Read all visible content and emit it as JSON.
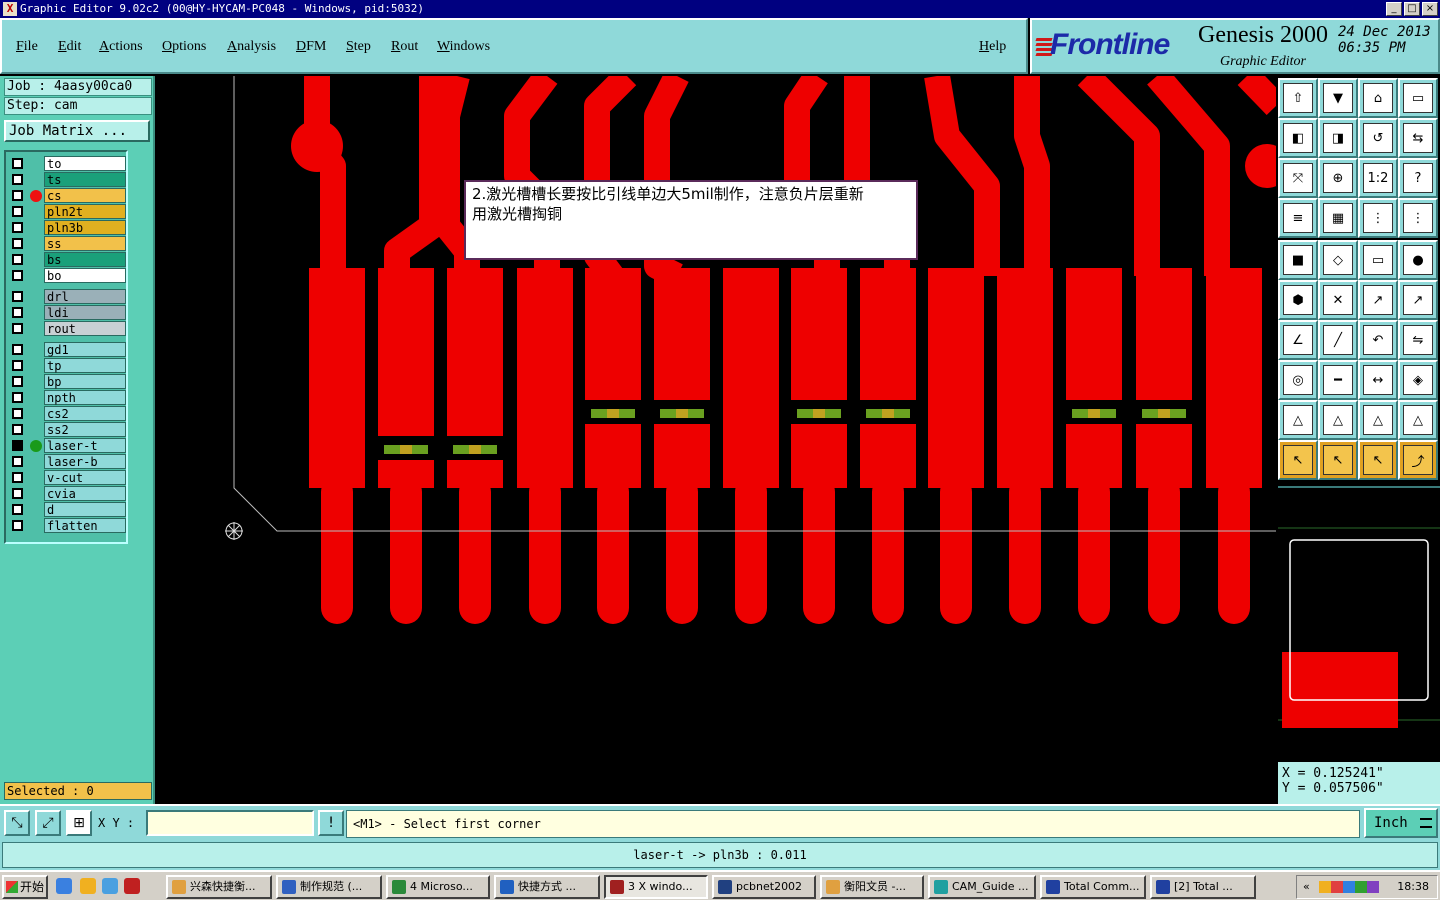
{
  "window": {
    "title": "Graphic Editor 9.02c2 (00@HY-HYCAM-PC048 - Windows, pid:5032)",
    "controls": [
      "_",
      "□",
      "×"
    ]
  },
  "menu": {
    "items": [
      "File",
      "Edit",
      "Actions",
      "Options",
      "Analysis",
      "DFM",
      "Step",
      "Rout",
      "Windows"
    ],
    "help": "Help"
  },
  "brand": {
    "logo": "Frontline",
    "product": "Genesis 2000",
    "subtitle": "Graphic Editor",
    "date": "24 Dec 2013",
    "time": "06:35 PM"
  },
  "job": {
    "job_line": "Job : 4aasy00ca0",
    "step_line": "Step: cam",
    "matrix_button": "Job Matrix ..."
  },
  "layers": [
    {
      "name": "to",
      "color": "#ffffff",
      "checked": false,
      "dot": ""
    },
    {
      "name": "ts",
      "color": "#1aa07a",
      "checked": false,
      "dot": ""
    },
    {
      "name": "cs",
      "color": "#f2c14a",
      "checked": false,
      "dot": "#ee1111"
    },
    {
      "name": "pln2t",
      "color": "#e0b020",
      "checked": false,
      "dot": ""
    },
    {
      "name": "pln3b",
      "color": "#e0b020",
      "checked": false,
      "dot": ""
    },
    {
      "name": "ss",
      "color": "#f2c14a",
      "checked": false,
      "dot": ""
    },
    {
      "name": "bs",
      "color": "#1aa07a",
      "checked": false,
      "dot": ""
    },
    {
      "name": "bo",
      "color": "#ffffff",
      "checked": false,
      "dot": ""
    },
    {
      "name": "drl",
      "color": "#9ab0b8",
      "checked": false,
      "dot": ""
    },
    {
      "name": "ldi",
      "color": "#9ab0b8",
      "checked": false,
      "dot": ""
    },
    {
      "name": "rout",
      "color": "#c8d0d4",
      "checked": false,
      "dot": ""
    },
    {
      "name": "gd1",
      "color": "#8fd9d9",
      "checked": false,
      "dot": ""
    },
    {
      "name": "tp",
      "color": "#8fd9d9",
      "checked": false,
      "dot": ""
    },
    {
      "name": "bp",
      "color": "#8fd9d9",
      "checked": false,
      "dot": ""
    },
    {
      "name": "npth",
      "color": "#8fd9d9",
      "checked": false,
      "dot": ""
    },
    {
      "name": "cs2",
      "color": "#8fd9d9",
      "checked": false,
      "dot": ""
    },
    {
      "name": "ss2",
      "color": "#8fd9d9",
      "checked": false,
      "dot": ""
    },
    {
      "name": "laser-t",
      "color": "#8fd9d9",
      "checked": true,
      "dot": "#1a9a1a"
    },
    {
      "name": "laser-b",
      "color": "#8fd9d9",
      "checked": false,
      "dot": ""
    },
    {
      "name": "v-cut",
      "color": "#8fd9d9",
      "checked": false,
      "dot": ""
    },
    {
      "name": "cvia",
      "color": "#8fd9d9",
      "checked": false,
      "dot": ""
    },
    {
      "name": "d",
      "color": "#8fd9d9",
      "checked": false,
      "dot": ""
    },
    {
      "name": "flatten",
      "color": "#8fd9d9",
      "checked": false,
      "dot": ""
    }
  ],
  "selected_text": "Selected : 0",
  "note": {
    "line1": "2.激光槽槽长要按比引线单边大5mil制作，注意负片层重新",
    "line2": "用激光槽掏铜"
  },
  "tools": [
    "top-icon",
    "save-icon",
    "home-icon",
    "window-icon",
    "left-icon",
    "right-icon",
    "undo-icon",
    "swap-icon",
    "fit-icon",
    "zoom-icon",
    "one-to-one-icon",
    "help-icon",
    "layers-icon",
    "grid-icon",
    "snap-icon",
    "snap2-icon",
    "pad-icon",
    "edit-icon",
    "ruler-icon",
    "dot-icon",
    "connect-icon",
    "cross-icon",
    "move-icon",
    "move2-icon",
    "angle-icon",
    "line-icon",
    "arc-icon",
    "flip-icon",
    "add-icon",
    "minus-icon",
    "measure-icon",
    "merge-icon",
    "triangle-icon",
    "triangle2-icon",
    "triangle3-icon",
    "triangle4-icon",
    "pointer-icon",
    "pointer2-icon",
    "pointer3-icon",
    "route-icon"
  ],
  "tool_labels": {
    "one_to_one": "1:2",
    "help": "?"
  },
  "coords": {
    "x": "X = 0.125241\"",
    "y": "Y = 0.057506\""
  },
  "bottom": {
    "xy_label": "X Y :",
    "xy_value": "",
    "alert": "!",
    "prompt": "<M1> - Select first corner",
    "unit": "Inch",
    "status": "laser-t -> pln3b : 0.011"
  },
  "taskbar": {
    "start": "开始",
    "tasks": [
      {
        "label": "兴森快捷衡...",
        "color": "#e0a040",
        "active": false
      },
      {
        "label": "制作规范 (...",
        "color": "#3060c0",
        "active": false
      },
      {
        "label": "4 Microso...",
        "color": "#2a8a3a",
        "active": false
      },
      {
        "label": "快捷方式 ...",
        "color": "#2060c0",
        "active": false
      },
      {
        "label": "3 X windo...",
        "color": "#a02020",
        "active": true
      },
      {
        "label": "pcbnet2002",
        "color": "#204080",
        "active": false
      },
      {
        "label": "衡阳文员 -...",
        "color": "#e0a040",
        "active": false
      },
      {
        "label": "CAM_Guide ...",
        "color": "#20a0a0",
        "active": false
      },
      {
        "label": "Total Comm...",
        "color": "#2040a0",
        "active": false
      },
      {
        "label": "[2] Total ...",
        "color": "#2040a0",
        "active": false
      }
    ],
    "clock": "18:38"
  },
  "colors": {
    "copper": "#ee0000",
    "laser": "#6aa020",
    "panel": "#8fd9d9",
    "teal": "#5ccfb6"
  }
}
